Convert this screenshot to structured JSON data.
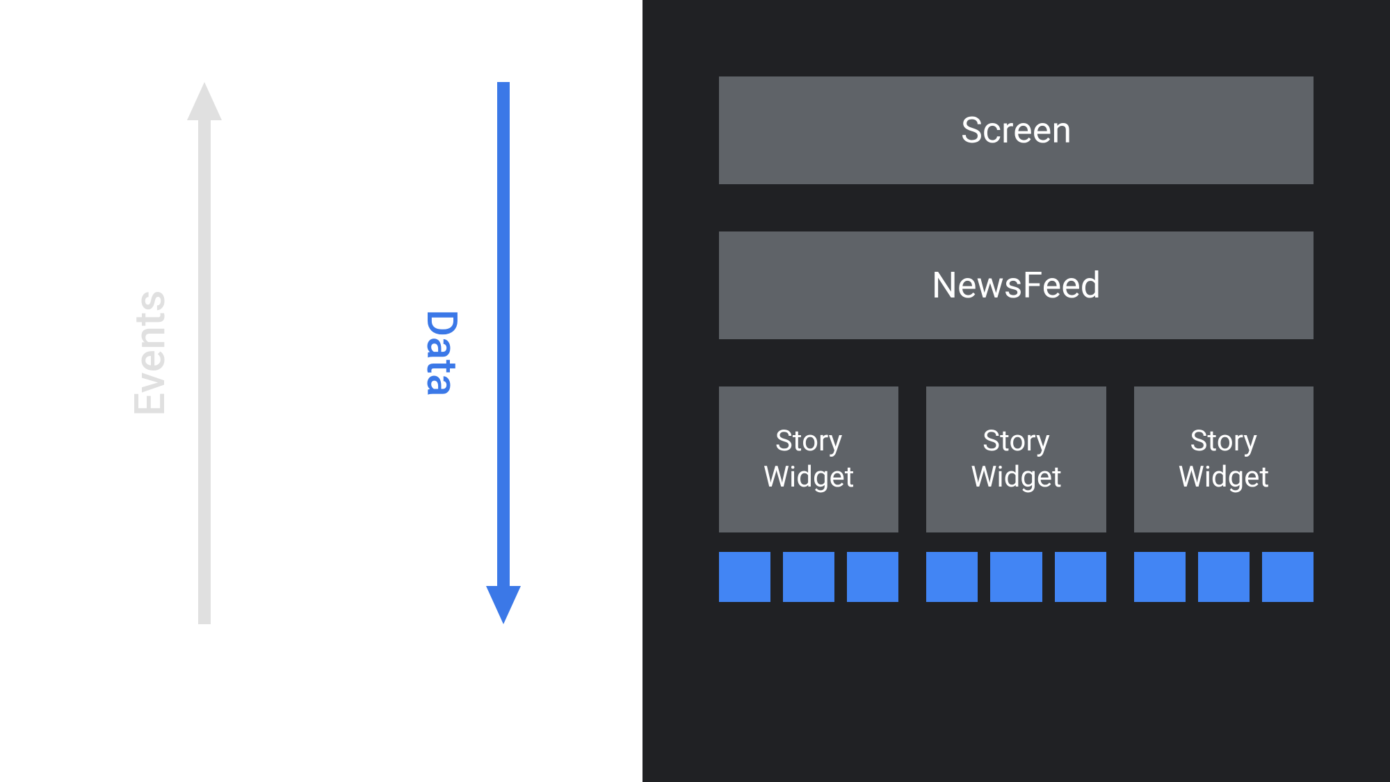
{
  "arrows": {
    "events_label": "Events",
    "data_label": "Data"
  },
  "hierarchy": {
    "screen_label": "Screen",
    "newsfeed_label": "NewsFeed",
    "story_widgets": [
      {
        "label": "Story\nWidget"
      },
      {
        "label": "Story\nWidget"
      },
      {
        "label": "Story\nWidget"
      }
    ]
  },
  "colors": {
    "events_arrow": "#e0e0e0",
    "data_arrow": "#3b78e7",
    "box_bg": "#5f6368",
    "blue_block": "#4285f4",
    "dark_bg": "#202124"
  }
}
